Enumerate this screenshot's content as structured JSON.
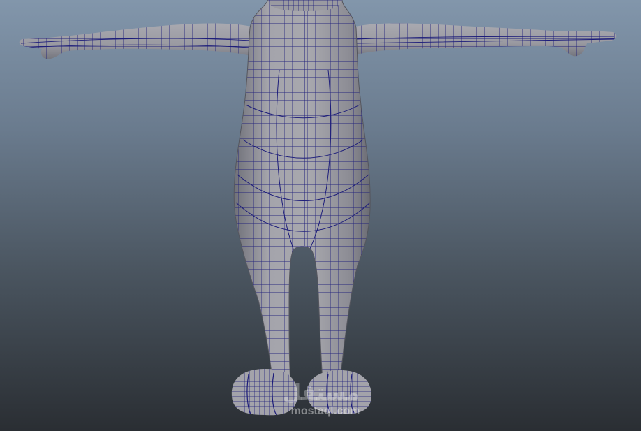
{
  "viewport": {
    "background_top": "#8296ab",
    "background_bottom": "#2a2e33"
  },
  "model": {
    "surface_color": "#9c9ca3",
    "wire_color": "#1a1a78",
    "shading_dark": "#6f7078"
  },
  "watermark": {
    "arabic": "مستقل",
    "latin": "mostaql.com"
  }
}
